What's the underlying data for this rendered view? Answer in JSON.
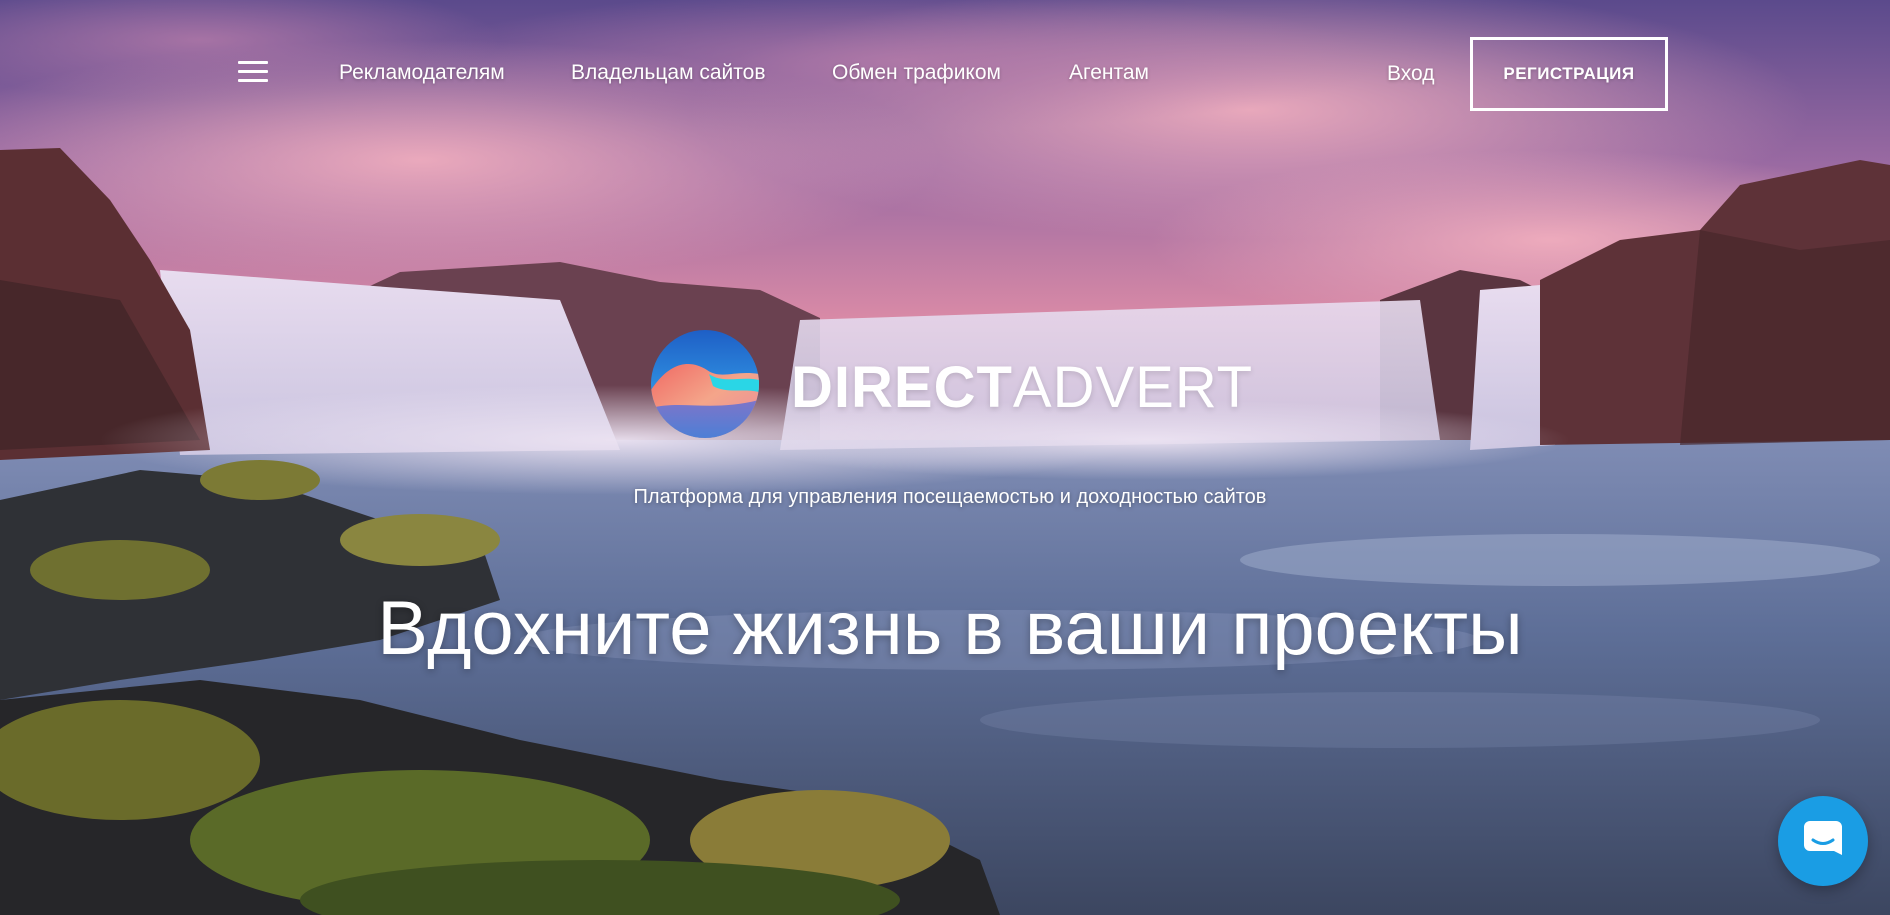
{
  "header": {
    "menu_icon": "hamburger-menu-icon",
    "nav": [
      {
        "label": "Рекламодателям"
      },
      {
        "label": "Владельцам сайтов"
      },
      {
        "label": "Обмен трафиком"
      },
      {
        "label": "Агентам"
      }
    ],
    "login_label": "Вход",
    "register_label": "РЕГИСТРАЦИЯ"
  },
  "logo": {
    "icon": "wave-circle-logo-icon",
    "text_bold": "DIRECT",
    "text_light": "ADVERT"
  },
  "hero": {
    "background": "waterfall-sunset-photo",
    "subtitle": "Платформа для управления посещаемостью и доходностью сайтов",
    "headline": "Вдохните жизнь в ваши проекты"
  },
  "chat": {
    "icon": "chat-bubble-icon",
    "color": "#1a9de4"
  },
  "colors": {
    "text": "#ffffff",
    "accent": "#1a9de4"
  }
}
